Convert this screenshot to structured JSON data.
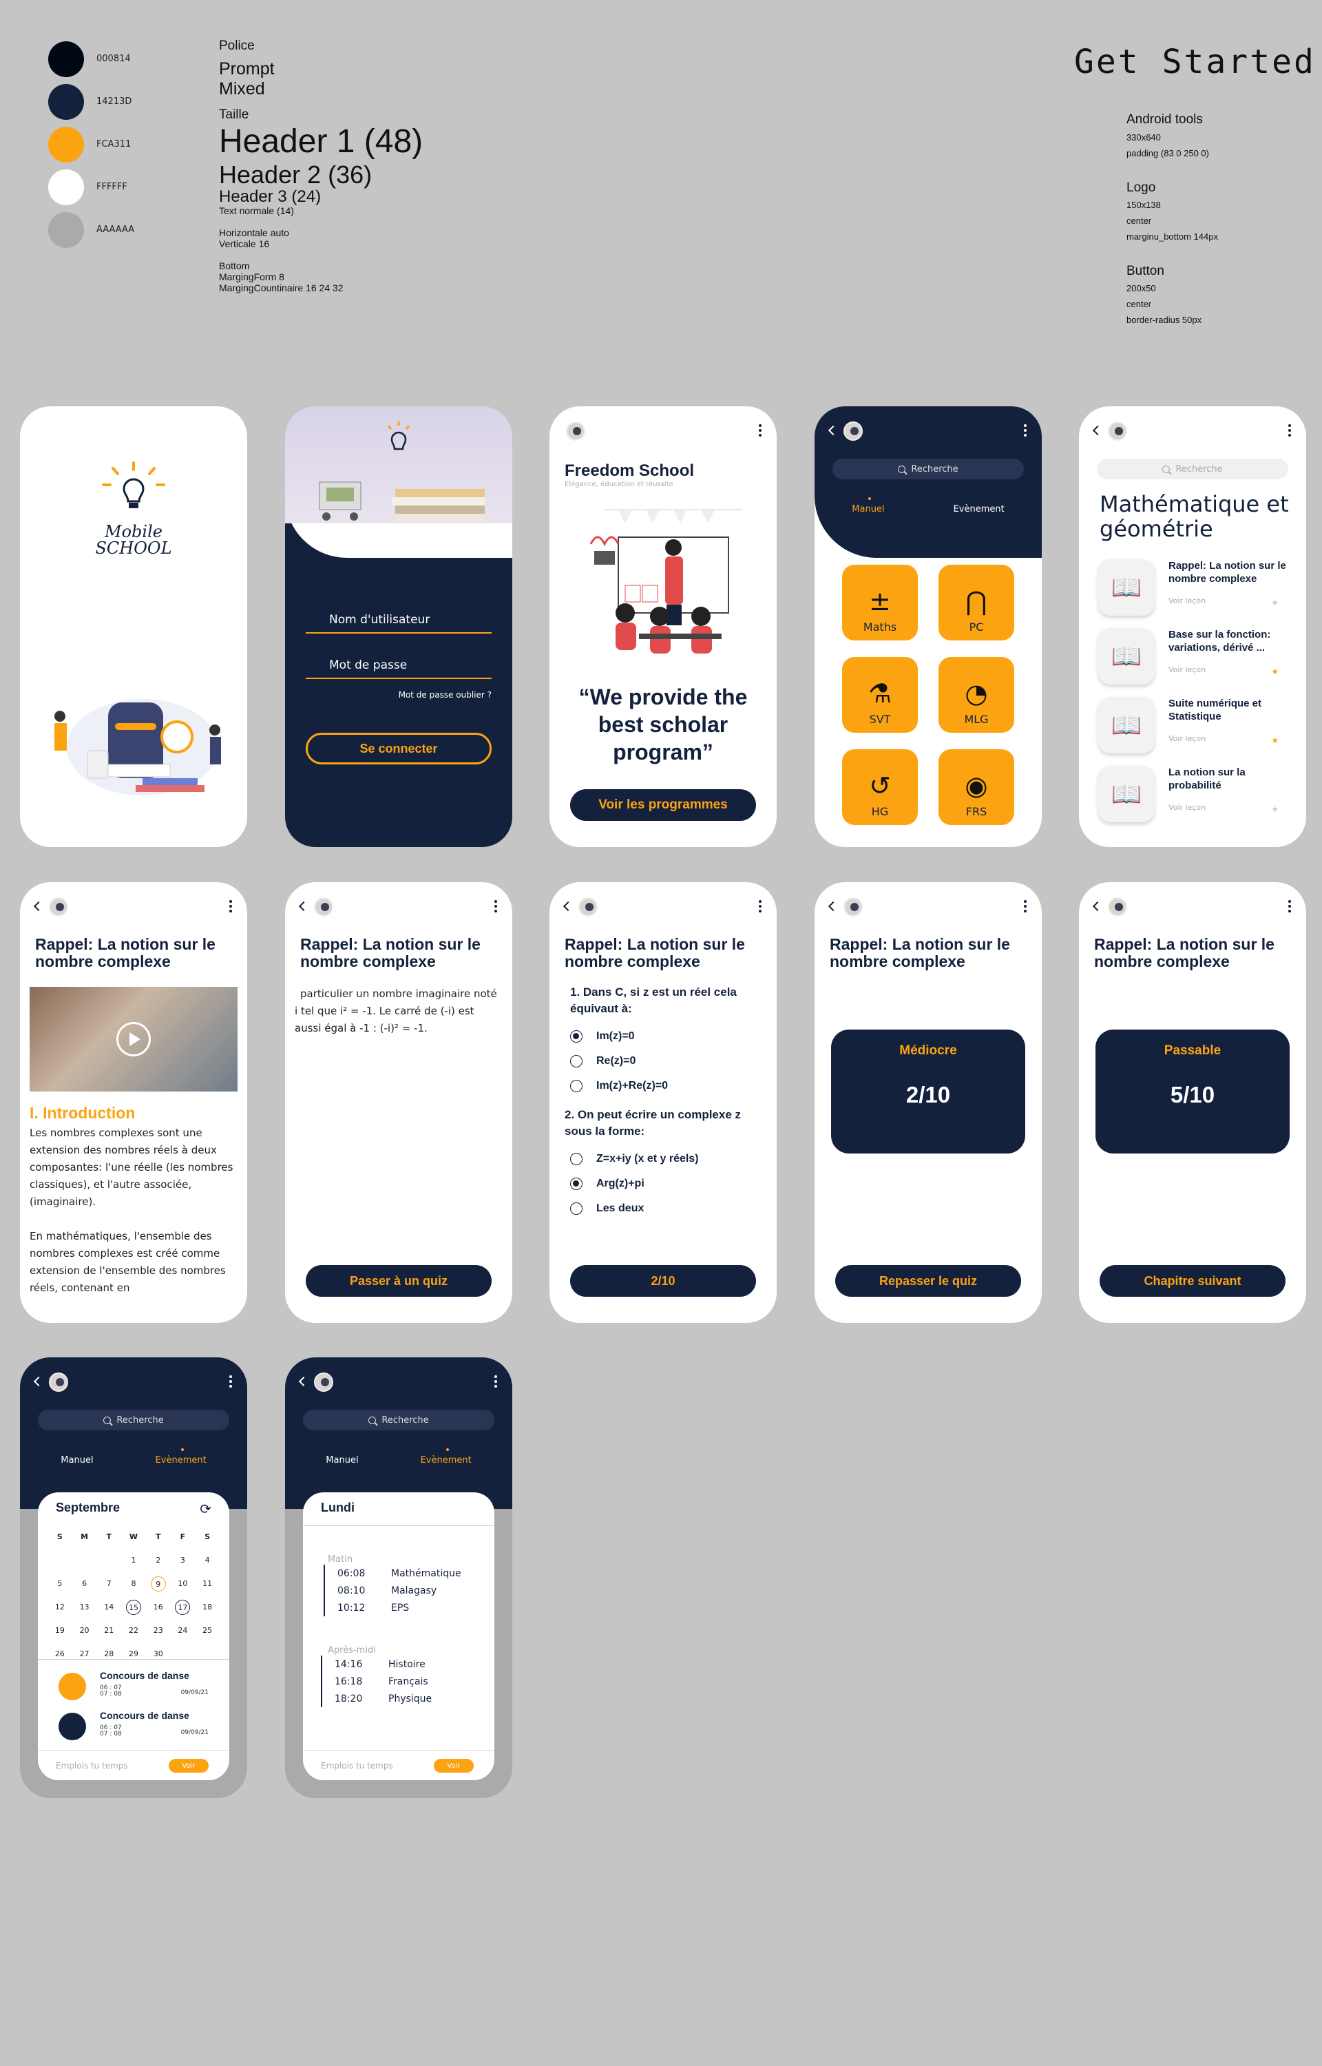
{
  "palette": [
    {
      "hex": "#000814",
      "label": "000814"
    },
    {
      "hex": "#14213D",
      "label": "14213D"
    },
    {
      "hex": "#FCA311",
      "label": "FCA311"
    },
    {
      "hex": "#FFFFFF",
      "label": "FFFFFF"
    },
    {
      "hex": "#AAAAAA",
      "label": "AAAAAA"
    }
  ],
  "typo": {
    "police": "Police",
    "font1": "Prompt",
    "font2": "Mixed",
    "taille": "Taille",
    "h1": "Header 1 (48)",
    "h2": "Header 2 (36)",
    "h3": "Header 3 (24)",
    "text": "Text normale (14)",
    "horiz": "Horizontale auto",
    "vert": "Verticale 16",
    "bottom": "Bottom",
    "marginForm": "MargingForm 8",
    "marginCont": "MargingCountinaire 16 24 32"
  },
  "spec": {
    "title": "Get Started",
    "s1": "Android tools",
    "s1a": "330x640",
    "s1b": "padding (83 0 250 0)",
    "s2": "Logo",
    "s2a": "150x138",
    "s2b": "center",
    "s2c": "marginu_bottom  144px",
    "s3": "Button",
    "s3a": "200x50",
    "s3b": "center",
    "s3c": "border-radius 50px"
  },
  "splash": {
    "logo1": "Mobile",
    "logo2": "SCHOOL"
  },
  "login": {
    "user": "Nom d'utilisateur",
    "pass": "Mot de passe",
    "forgot": "Mot de passe oublier ?",
    "btn": "Se connecter"
  },
  "welcome": {
    "brand": "Freedom School",
    "tagline": "Elégance, éducation et réussite",
    "quote": "“We provide the best scholar program”",
    "btn": "Voir les programmes"
  },
  "subjects": {
    "search": "Recherche",
    "tab1": "Manuel",
    "tab2": "Evènement",
    "items": [
      "Maths",
      "PC",
      "SVT",
      "MLG",
      "HG",
      "FRS"
    ]
  },
  "lessons": {
    "search": "Recherche",
    "title": "Mathématique et géométrie",
    "items": [
      {
        "t": "Rappel: La notion sur le nombre complexe",
        "v": "Voir leçon"
      },
      {
        "t": "Base sur la fonction: variations, dérivé ...",
        "v": "Voir leçon"
      },
      {
        "t": "Suite numérique et Statistique",
        "v": "Voir leçon"
      },
      {
        "t": "La notion sur la probabilité",
        "v": "Voir leçon"
      }
    ]
  },
  "lessonTitle": "Rappel: La notion sur le nombre complexe",
  "intro": {
    "h": "I. Introduction",
    "p1": "Les nombres complexes sont une extension des nombres réels à deux composantes: l'une réelle (les nombres classiques), et l'autre associée, (imaginaire).",
    "p2": "En mathématiques, l'ensemble des nombres complexes est créé comme extension de l'ensemble des nombres réels, contenant en"
  },
  "part2": {
    "p": "particulier un nombre imaginaire noté i tel que i² = -1. Le carré de (-i) est aussi égal à -1 : (-i)² = -1.",
    "btn": "Passer à un quiz"
  },
  "quiz": {
    "q1": "1. Dans C, si z est un réel cela équivaut à:",
    "o1": [
      "Im(z)=0",
      "Re(z)=0",
      "Im(z)+Re(z)=0"
    ],
    "q2": "2. On peut écrire un complexe z sous la forme:",
    "o2": [
      "Z=x+iy (x et y réels)",
      "Arg(z)+pi",
      "Les deux"
    ],
    "btn": "2/10"
  },
  "res1": {
    "lab": "Médiocre",
    "val": "2/10",
    "btn": "Repasser le quiz"
  },
  "res2": {
    "lab": "Passable",
    "val": "5/10",
    "btn": "Chapitre suivant"
  },
  "events": {
    "search": "Recherche",
    "tab1": "Manuel",
    "tab2": "Evènement",
    "month": "Septembre",
    "days": [
      "S",
      "M",
      "T",
      "W",
      "T",
      "F",
      "S"
    ],
    "dates": [
      "",
      "",
      "",
      "1",
      "2",
      "3",
      "4",
      "5",
      "6",
      "7",
      "8",
      "9",
      "10",
      "11",
      "12",
      "13",
      "14",
      "15",
      "16",
      "17",
      "18",
      "19",
      "20",
      "21",
      "22",
      "23",
      "24",
      "25",
      "26",
      "27",
      "28",
      "29",
      "30",
      "",
      ""
    ],
    "ev": [
      {
        "t": "Concours de danse",
        "s1": "06 : 07",
        "s2": "07 : 08",
        "d": "09/09/21"
      },
      {
        "t": "Concours de danse",
        "s1": "06 : 07",
        "s2": "07 : 08",
        "d": "09/09/21"
      }
    ],
    "foot": "Emplois tu temps",
    "vbtn": "Voir"
  },
  "schedule": {
    "search": "Recherche",
    "tab1": "Manuel",
    "tab2": "Evènement",
    "day": "Lundi",
    "m": "Matin",
    "mr": [
      {
        "t": "06:08",
        "s": "Mathématique"
      },
      {
        "t": "08:10",
        "s": "Malagasy"
      },
      {
        "t": "10:12",
        "s": "EPS"
      }
    ],
    "a": "Après-midi",
    "ar": [
      {
        "t": "14:16",
        "s": "Histoire"
      },
      {
        "t": "16:18",
        "s": "Français"
      },
      {
        "t": "18:20",
        "s": "Physique"
      }
    ],
    "foot": "Emplois tu temps",
    "vbtn": "Voir"
  }
}
